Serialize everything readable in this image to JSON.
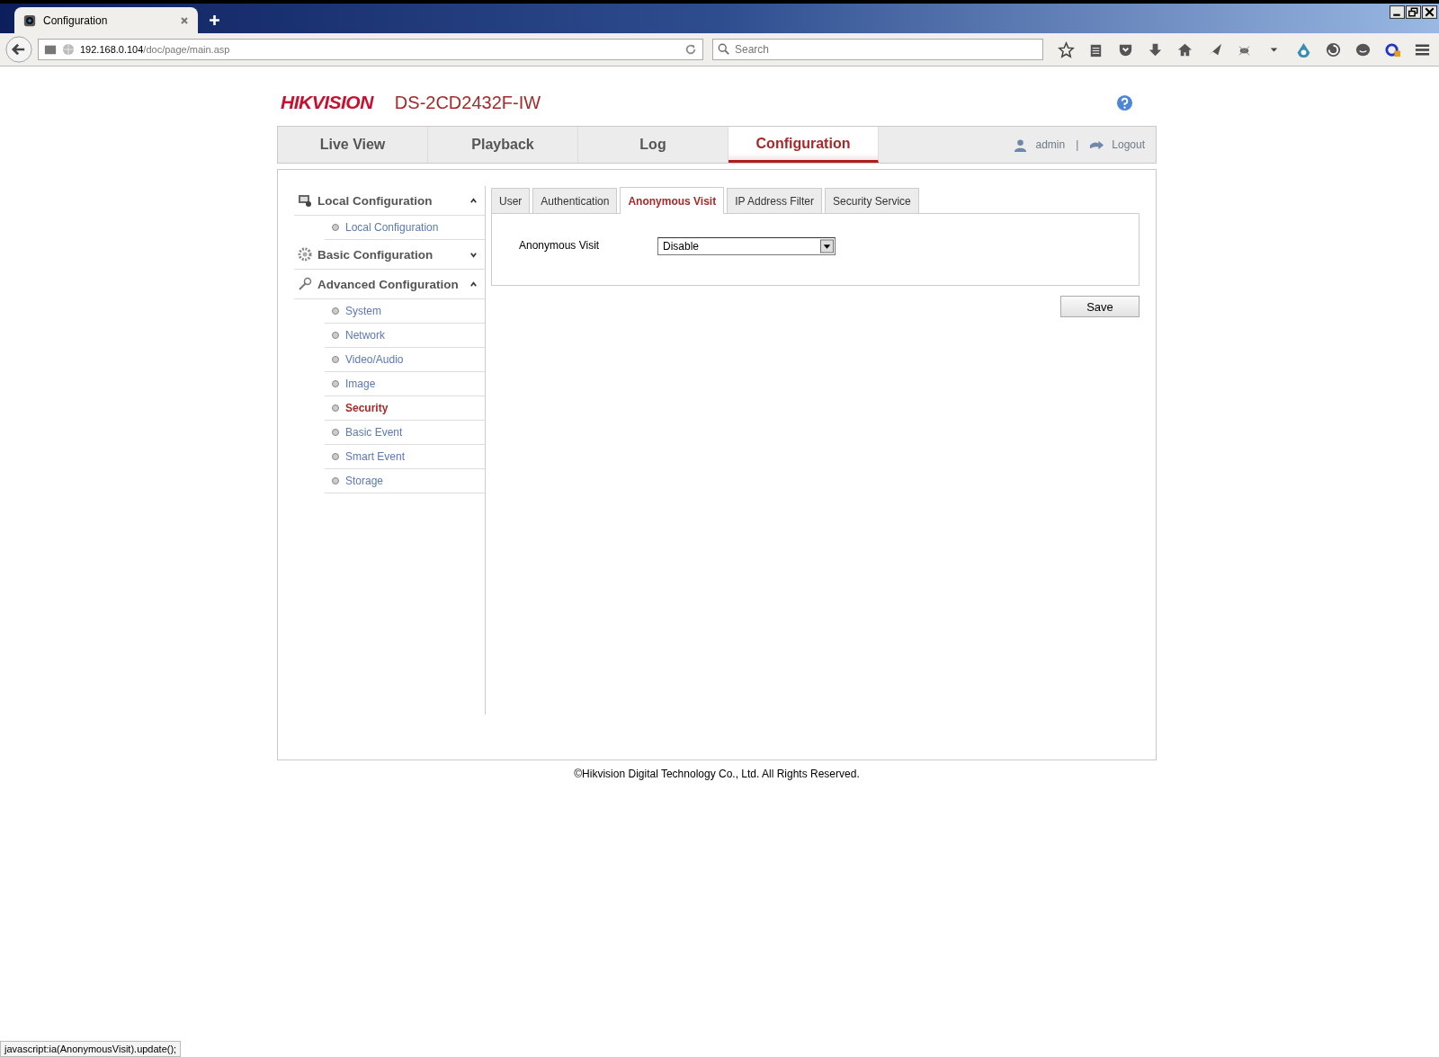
{
  "browser": {
    "tab_title": "Configuration",
    "url_host": "192.168.0.104",
    "url_path": "/doc/page/main.asp",
    "search_placeholder": "Search"
  },
  "header": {
    "logo": "HIKVISION",
    "model": "DS-2CD2432F-IW"
  },
  "nav": {
    "tabs": [
      {
        "label": "Live View",
        "selected": false
      },
      {
        "label": "Playback",
        "selected": false
      },
      {
        "label": "Log",
        "selected": false
      },
      {
        "label": "Configuration",
        "selected": true
      }
    ],
    "user": "admin",
    "separator": "|",
    "logout": "Logout"
  },
  "sidebar": {
    "sections": [
      {
        "kind": "local",
        "title": "Local Configuration",
        "expanded": true,
        "children": [
          {
            "label": "Local Configuration",
            "selected": false
          }
        ]
      },
      {
        "kind": "basic",
        "title": "Basic Configuration",
        "expanded": false
      },
      {
        "kind": "advanced",
        "title": "Advanced Configuration",
        "expanded": true,
        "children": [
          {
            "label": "System",
            "selected": false
          },
          {
            "label": "Network",
            "selected": false
          },
          {
            "label": "Video/Audio",
            "selected": false
          },
          {
            "label": "Image",
            "selected": false
          },
          {
            "label": "Security",
            "selected": true
          },
          {
            "label": "Basic Event",
            "selected": false
          },
          {
            "label": "Smart Event",
            "selected": false
          },
          {
            "label": "Storage",
            "selected": false
          }
        ]
      }
    ]
  },
  "subtabs": [
    {
      "label": "User",
      "selected": false
    },
    {
      "label": "Authentication",
      "selected": false
    },
    {
      "label": "Anonymous Visit",
      "selected": true
    },
    {
      "label": "IP Address Filter",
      "selected": false
    },
    {
      "label": "Security Service",
      "selected": false
    }
  ],
  "form": {
    "label": "Anonymous Visit",
    "value": "Disable"
  },
  "save": "Save",
  "footer": "©Hikvision Digital Technology Co., Ltd. All Rights Reserved.",
  "status_bar": "javascript:ia(AnonymousVisit).update();"
}
